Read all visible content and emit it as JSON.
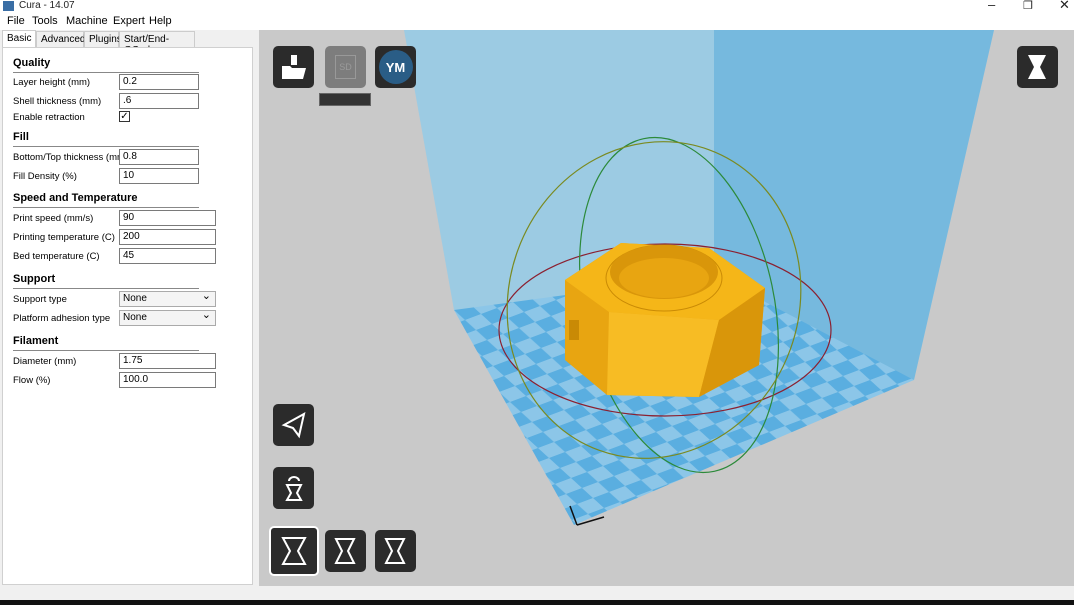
{
  "window": {
    "title": "Cura - 14.07"
  },
  "menu": [
    "File",
    "Tools",
    "Machine",
    "Expert",
    "Help"
  ],
  "tabs": [
    "Basic",
    "Advanced",
    "Plugins",
    "Start/End-GCode"
  ],
  "quality": {
    "title": "Quality",
    "layer_height_label": "Layer height (mm)",
    "layer_height": "0.2",
    "shell_label": "Shell thickness (mm)",
    "shell": ".6",
    "retraction_label": "Enable retraction",
    "retraction": true
  },
  "fill": {
    "title": "Fill",
    "bottom_top_label": "Bottom/Top thickness (mm)",
    "bottom_top": "0.8",
    "density_label": "Fill Density (%)",
    "density": "10"
  },
  "speed": {
    "title": "Speed and Temperature",
    "print_speed_label": "Print speed (mm/s)",
    "print_speed": "90",
    "temp_label": "Printing temperature (C)",
    "temp": "200",
    "bed_label": "Bed temperature (C)",
    "bed": "45"
  },
  "support": {
    "title": "Support",
    "type_label": "Support type",
    "type": "None",
    "adhesion_label": "Platform adhesion type",
    "adhesion": "None"
  },
  "filament": {
    "title": "Filament",
    "diameter_label": "Diameter (mm)",
    "diameter": "1.75",
    "flow_label": "Flow (%)",
    "flow": "100.0"
  },
  "toolbar": {
    "sd_label": "SD",
    "youmagine_label": "YM"
  },
  "colors": {
    "model": "#f5b618",
    "volume": "#7fc0e0",
    "floor_a": "#5aaee0",
    "floor_b": "#8cc6e8"
  }
}
